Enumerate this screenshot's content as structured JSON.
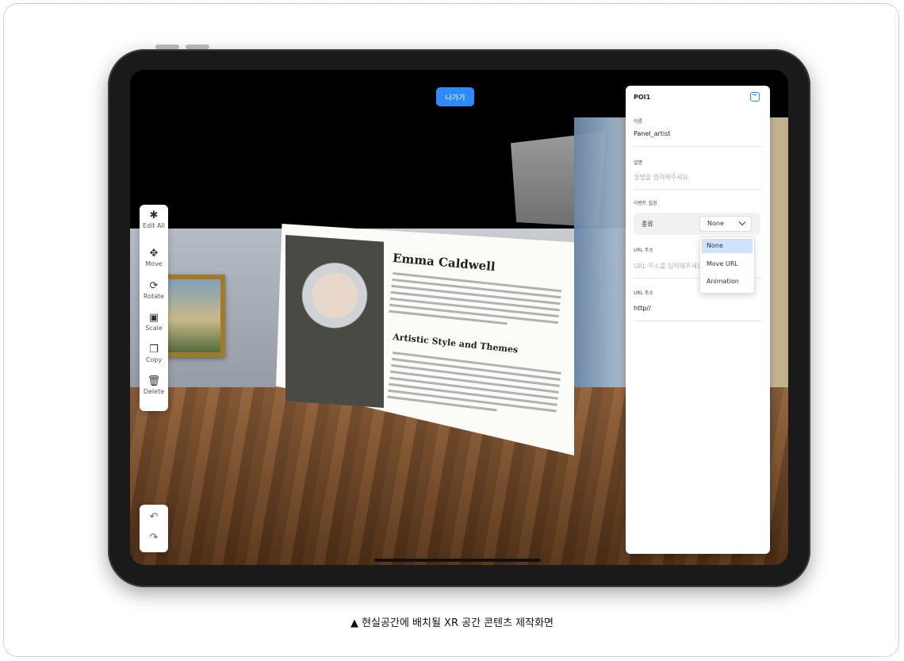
{
  "caption": "▲ 현실공간에 배치될 XR 공간 콘텐츠 제작화면",
  "top_button": "나가기",
  "toolbar": [
    {
      "icon": "edit-all-icon",
      "glyph": "✱",
      "label": "Edit All"
    },
    {
      "icon": "move-icon",
      "glyph": "✥",
      "label": "Move"
    },
    {
      "icon": "rotate-icon",
      "glyph": "⟳",
      "label": "Rotate"
    },
    {
      "icon": "scale-icon",
      "glyph": "▣",
      "label": "Scale"
    },
    {
      "icon": "copy-icon",
      "glyph": "❐",
      "label": "Copy"
    },
    {
      "icon": "delete-icon",
      "glyph": "🗑",
      "label": "Delete"
    }
  ],
  "history": {
    "undo_glyph": "↶",
    "redo_glyph": "↷"
  },
  "card": {
    "title": "Emma Caldwell",
    "subtitle": "Artistic Style and Themes"
  },
  "props": {
    "title": "POI1",
    "name_label": "이름",
    "name_value": "Panel_artist",
    "desc_label": "설명",
    "desc_placeholder": "설명을 입력해주세요.",
    "event_label": "이벤트 설정",
    "type_label": "종류",
    "type_value": "None",
    "url_label_1": "URL 주소",
    "url_placeholder": "URL 주소를 입력해주세요",
    "url_label_2": "URL 주소",
    "url_value": "http//",
    "options": [
      "None",
      "Move URL",
      "Animation"
    ]
  }
}
